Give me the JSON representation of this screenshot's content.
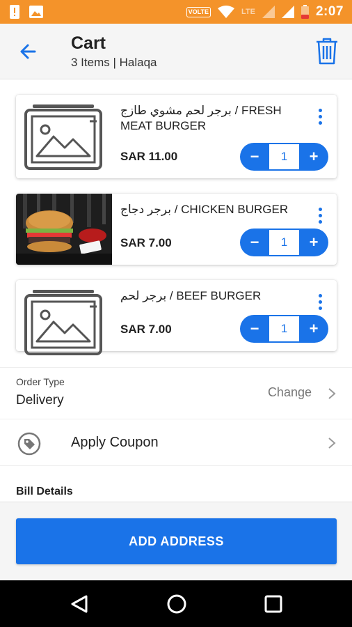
{
  "status_bar": {
    "time": "2:07",
    "volte": "VOLTE",
    "network": "LTE",
    "bg_color": "#f4932a",
    "icons": [
      "alert-icon",
      "image-icon",
      "wifi-icon",
      "signal-icon",
      "battery-icon"
    ]
  },
  "header": {
    "title": "Cart",
    "subtitle": "3 Items | Halaqa"
  },
  "cart_items": [
    {
      "name": "برجر لحم مشوي طازج / FRESH MEAT BURGER",
      "price": "SAR 11.00",
      "quantity": "1",
      "image": "placeholder-image-icon"
    },
    {
      "name": "برجر دجاج / CHICKEN BURGER",
      "price": "SAR 7.00",
      "quantity": "1",
      "image": "burger-photo"
    },
    {
      "name": "برجر لحم / BEEF BURGER",
      "price": "SAR 7.00",
      "quantity": "1",
      "image": "placeholder-image-icon"
    }
  ],
  "stepper": {
    "minus": "−",
    "plus": "+"
  },
  "order_type": {
    "label": "Order Type",
    "value": "Delivery",
    "action": "Change"
  },
  "coupon": {
    "label": "Apply Coupon"
  },
  "bill": {
    "title": "Bill Details"
  },
  "primary_action": {
    "label": "ADD ADDRESS"
  },
  "colors": {
    "accent": "#1a73e8",
    "status_bar": "#f4932a"
  }
}
